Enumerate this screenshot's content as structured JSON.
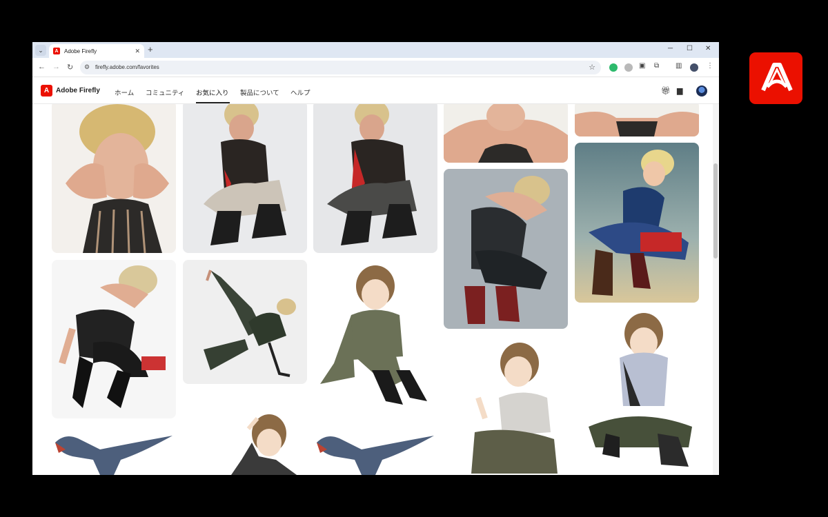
{
  "browser": {
    "tab_title": "Adobe Firefly",
    "url": "firefly.adobe.com/favorites",
    "win_min": "─",
    "win_max": "☐",
    "win_close": "✕"
  },
  "app": {
    "name": "Adobe Firefly",
    "nav": [
      "ホーム",
      "コミュニティ",
      "お気に入り",
      "製品について",
      "ヘルプ"
    ],
    "active_nav": "お気に入り"
  },
  "gallery": {
    "items": [
      {
        "desc": "photo-portrait-hands-face"
      },
      {
        "desc": "photo-crouching-boots"
      },
      {
        "desc": "photo-crouching-boots-2"
      },
      {
        "desc": "photo-hands-face-top"
      },
      {
        "desc": "photo-top-crop"
      },
      {
        "desc": "photo-crouching-leather"
      },
      {
        "desc": "illustration-crouching-blue"
      },
      {
        "desc": "photo-crouching-black"
      },
      {
        "desc": "photo-legs-up-pose"
      },
      {
        "desc": "anime-sitting-jacket"
      },
      {
        "desc": "anime-sitting-pants"
      },
      {
        "desc": "anime-sitting-vest"
      },
      {
        "desc": "dinosaur-render"
      },
      {
        "desc": "anime-hand-head"
      },
      {
        "desc": "dinosaur-render-2"
      }
    ]
  },
  "colors": {
    "adobe_red": "#eb1000"
  }
}
